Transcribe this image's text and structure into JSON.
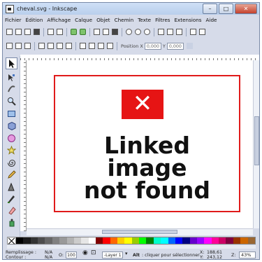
{
  "window": {
    "title": "cheval.svg - Inkscape"
  },
  "window_controls": {
    "minimize": "–",
    "maximize": "□",
    "close": "✕"
  },
  "menubar": {
    "items": [
      "Fichier",
      "Édition",
      "Affichage",
      "Calque",
      "Objet",
      "Chemin",
      "Texte",
      "Filtres",
      "Extensions",
      "Aide"
    ]
  },
  "controls_bar": {
    "position_x_label": "Position X",
    "position_x_value": "0,000",
    "y_label": "Y",
    "y_value": "0,000"
  },
  "canvas": {
    "placeholder_text": [
      "Linked",
      "image",
      "not found"
    ],
    "placeholder_icon": "✕"
  },
  "palette": {
    "colors": [
      "#000000",
      "#1a1a1a",
      "#333333",
      "#4d4d4d",
      "#666666",
      "#808080",
      "#999999",
      "#b3b3b3",
      "#cccccc",
      "#e6e6e6",
      "#ffffff",
      "#800000",
      "#ff0000",
      "#ff6600",
      "#ffcc00",
      "#ffff00",
      "#99cc00",
      "#00ff00",
      "#008000",
      "#00ffcc",
      "#00ffff",
      "#0066ff",
      "#0000ff",
      "#000080",
      "#6600cc",
      "#9900ff",
      "#ff00ff",
      "#ff0099",
      "#cc0066",
      "#800040",
      "#993300",
      "#cc6600",
      "#996633"
    ]
  },
  "statusbar": {
    "fill_label": "Remplissage :",
    "stroke_label": "Contour :",
    "fill_value": "N/A",
    "stroke_value": "N/A",
    "opacity_label": "O:",
    "opacity_value": "100",
    "layer_value": "-Layer 1",
    "message_bold": "Alt",
    "message": ": cliquer pour sélectionner",
    "coords_x_label": "X:",
    "coords_y_label": "Y:",
    "coords_x": "188,61",
    "coords_y": "243,12",
    "zoom_label": "Z:",
    "zoom_value": "43%"
  }
}
